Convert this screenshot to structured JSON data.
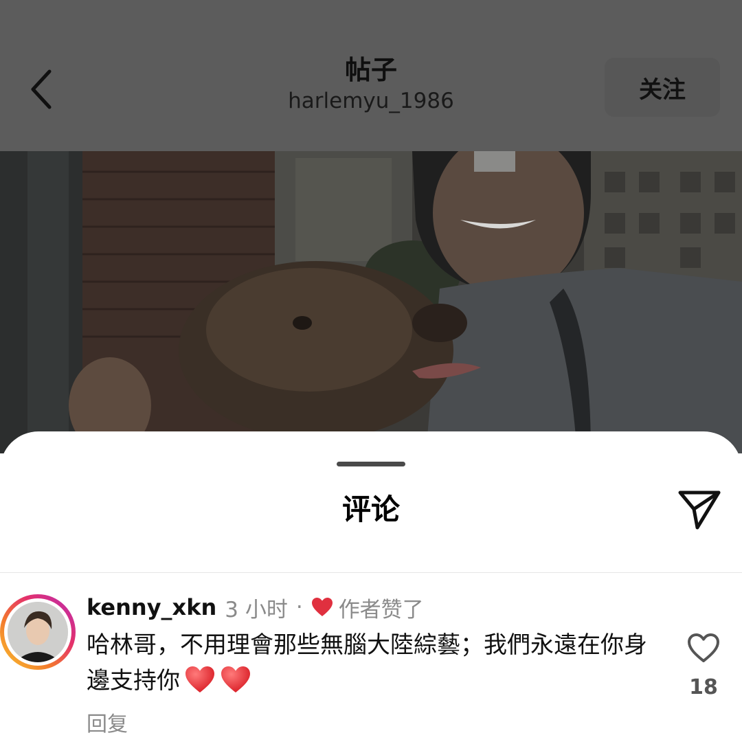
{
  "header": {
    "title": "帖子",
    "subtitle": "harlemyu_1986",
    "follow_label": "关注",
    "back_icon": "chevron-left-icon"
  },
  "sheet": {
    "title": "评论",
    "share_icon": "send-icon"
  },
  "comment": {
    "username": "kenny_xkn",
    "time": "3 小时",
    "separator": "·",
    "liked_by_author": "作者赞了",
    "text": "哈林哥，不用理會那些無腦大陸綜藝；我們永遠在你身邊支持你",
    "emojis": [
      "heart-emoji",
      "heart-emoji"
    ],
    "reply_label": "回复",
    "like_count": "18",
    "like_icon": "heart-outline-icon"
  },
  "colors": {
    "dim_overlay": "#5c5c5c",
    "heart_red": "#e0303f",
    "secondary_text": "#8a8a8a"
  }
}
